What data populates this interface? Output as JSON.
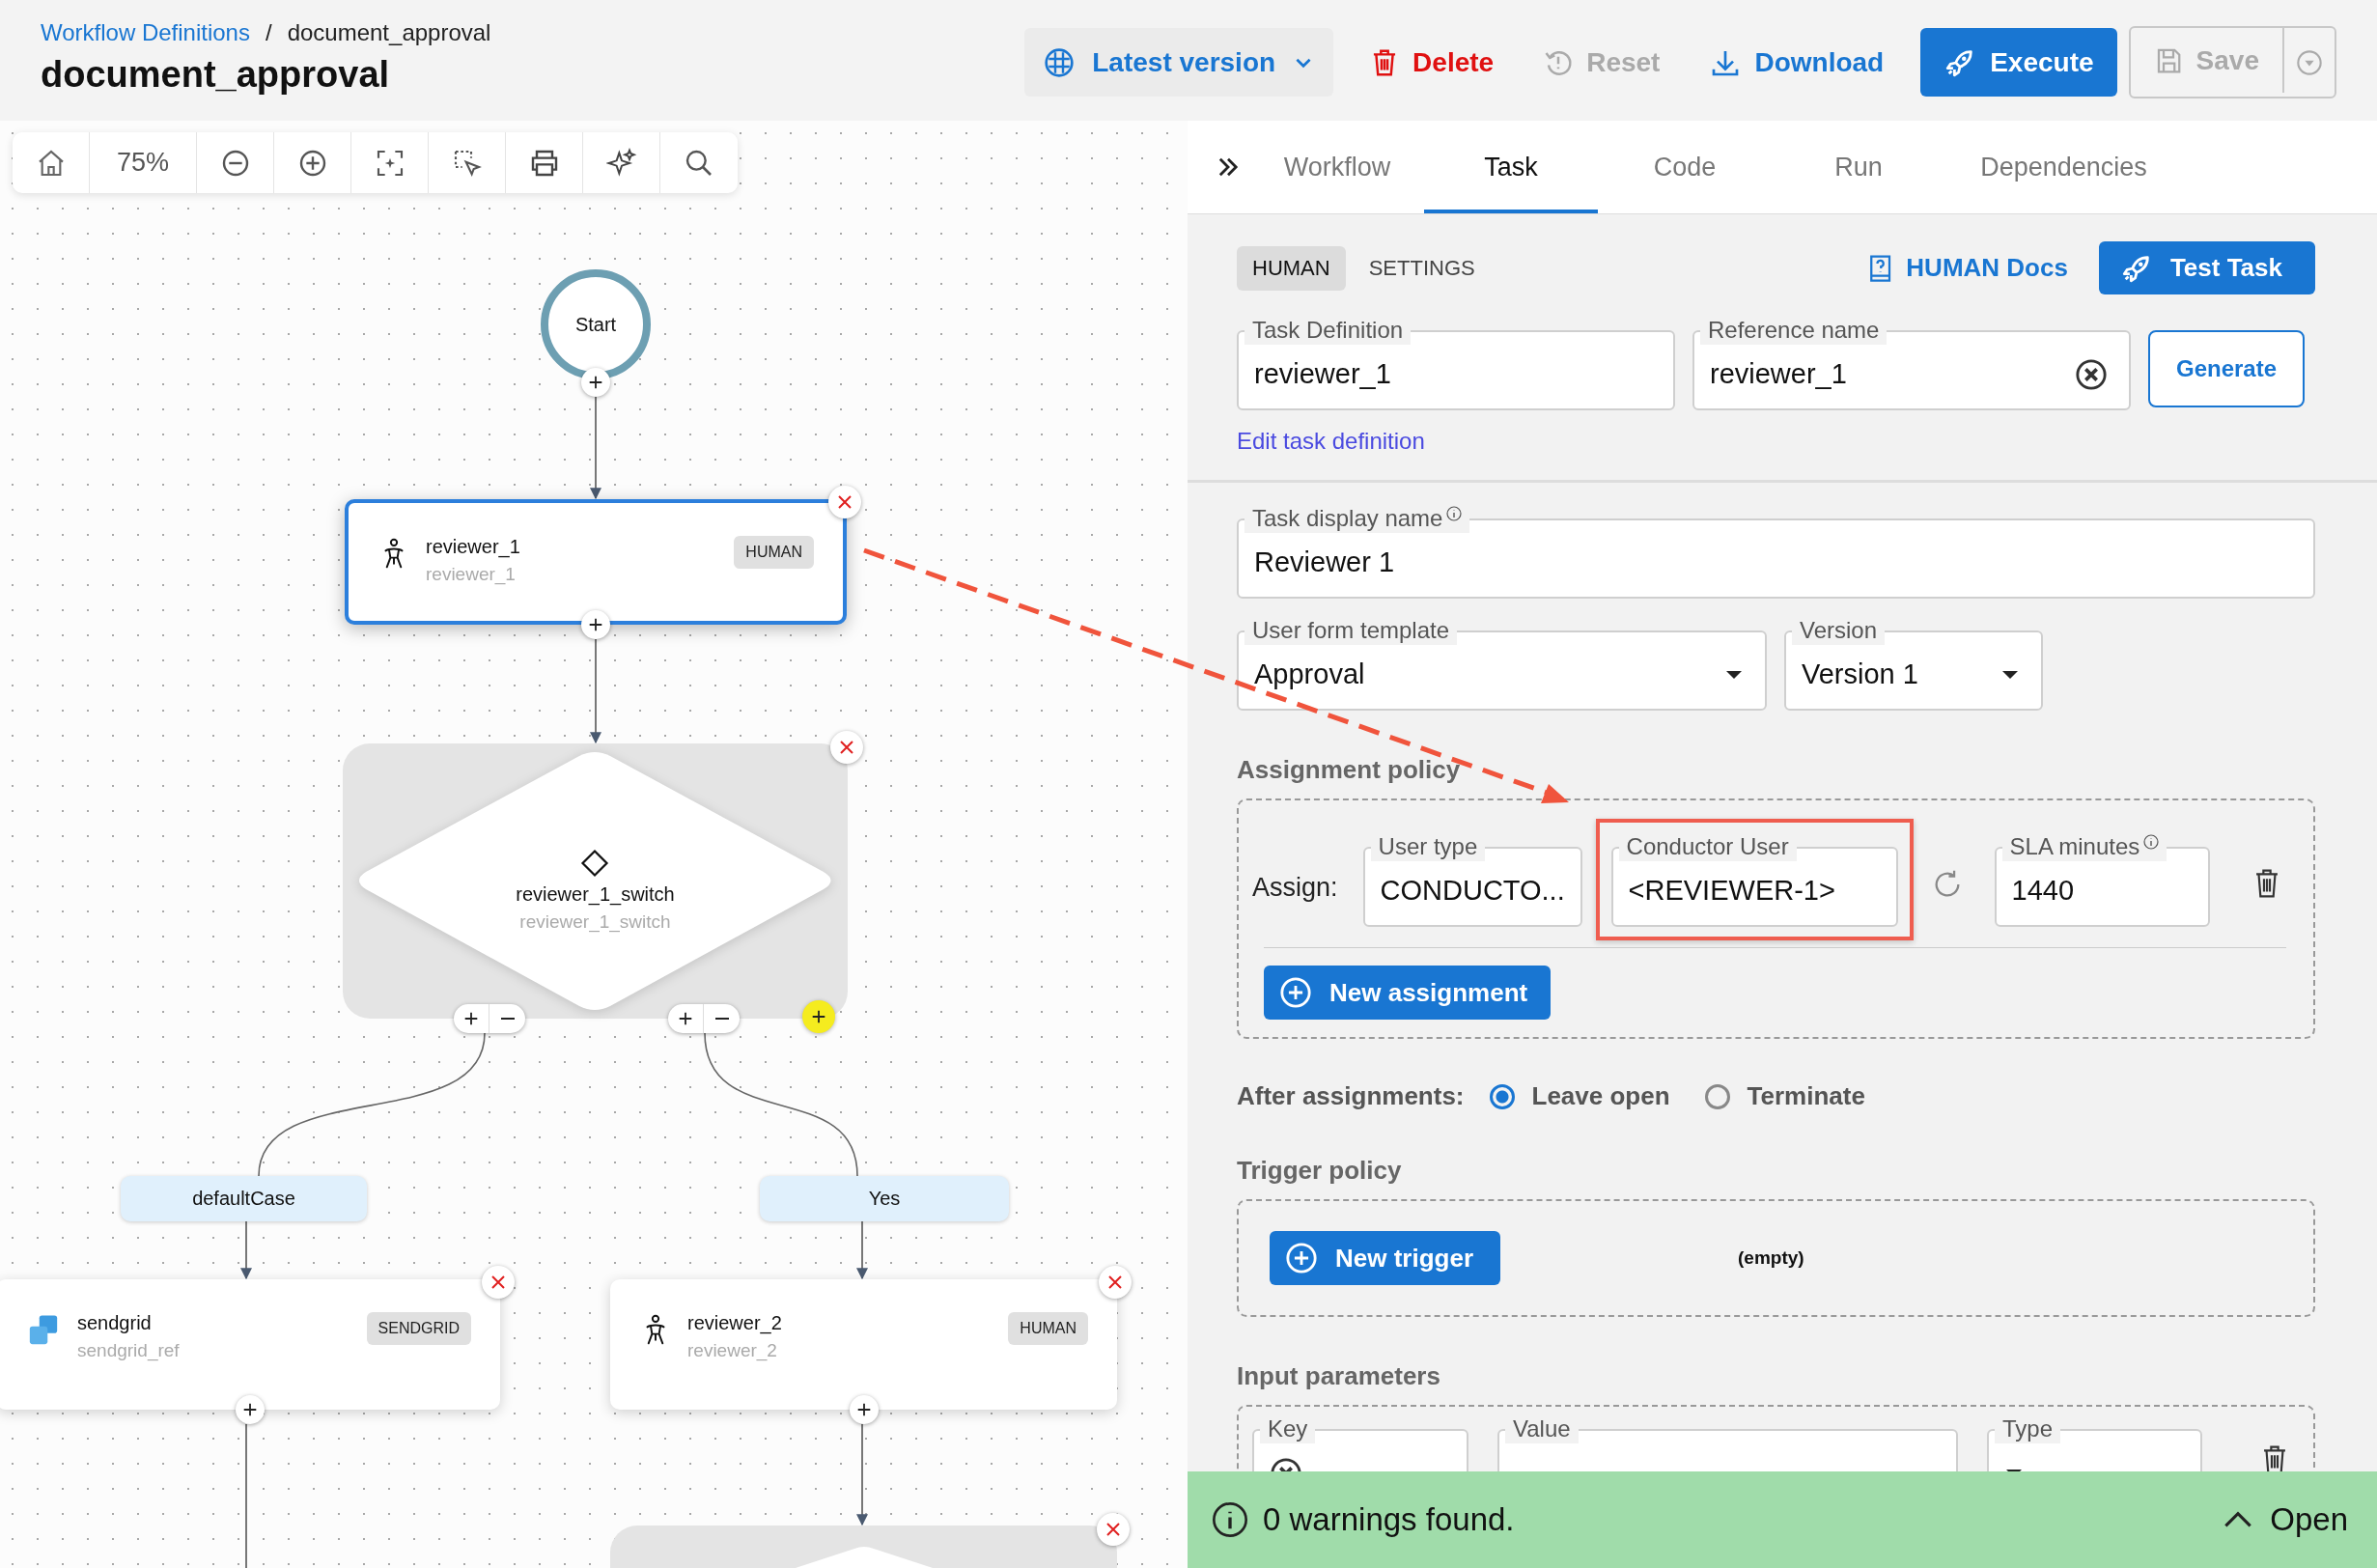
{
  "breadcrumb": [
    {
      "label": "Workflow Definitions",
      "kind": "link"
    },
    {
      "label": "document_approval",
      "kind": "current"
    }
  ],
  "breadcrumb_separator": "/",
  "title": "document_approval",
  "actions": [
    {
      "label": "Latest version",
      "kind": "version",
      "disabled": false
    },
    {
      "label": "Delete",
      "kind": "delete",
      "disabled": false
    },
    {
      "label": "Reset",
      "kind": "reset",
      "disabled": true
    },
    {
      "label": "Download",
      "kind": "download",
      "disabled": false
    },
    {
      "label": "Execute",
      "kind": "execute",
      "disabled": false
    },
    {
      "label": "Save",
      "kind": "save",
      "disabled": true
    }
  ],
  "zoom_level": "75%",
  "nodes": [
    {
      "kind": "start",
      "label": "Start"
    },
    {
      "kind": "human",
      "name": "reviewer_1",
      "ref": "reviewer_1",
      "type": "HUMAN",
      "selected": true
    },
    {
      "kind": "switch",
      "name": "reviewer_1_switch",
      "ref": "reviewer_1_switch"
    },
    {
      "kind": "sendgrid",
      "name": "sendgrid",
      "ref": "sendgrid_ref",
      "type": "SENDGRID",
      "selected": false
    },
    {
      "kind": "human",
      "name": "reviewer_2",
      "ref": "reviewer_2",
      "type": "HUMAN",
      "selected": false
    },
    {
      "kind": "switch-stub"
    }
  ],
  "branches": [
    {
      "label": "defaultCase"
    },
    {
      "label": "Yes"
    }
  ],
  "panel": {
    "tabs": [
      {
        "label": "Workflow",
        "selected": false
      },
      {
        "label": "Task",
        "selected": true
      },
      {
        "label": "Code",
        "selected": false
      },
      {
        "label": "Run",
        "selected": false
      },
      {
        "label": "Dependencies",
        "selected": false
      }
    ],
    "subtabs": [
      {
        "label": "HUMAN",
        "selected": true
      },
      {
        "label": "SETTINGS",
        "selected": false
      }
    ],
    "docs_link": "HUMAN Docs",
    "test_button": "Test Task",
    "task_definition": {
      "label": "Task Definition",
      "value": "reviewer_1"
    },
    "reference_name": {
      "label": "Reference name",
      "value": "reviewer_1"
    },
    "generate_button": "Generate",
    "edit_link": "Edit task definition",
    "display_name": {
      "label": "Task display name",
      "value": "Reviewer 1"
    },
    "user_form_template": {
      "label": "User form template",
      "value": "Approval"
    },
    "version": {
      "label": "Version",
      "value": "Version 1"
    },
    "assignment_policy": {
      "heading": "Assignment policy",
      "assign_label": "Assign:",
      "user_type": {
        "label": "User type",
        "value": "CONDUCTO..."
      },
      "conductor_user": {
        "label": "Conductor User",
        "value": "<REVIEWER-1>",
        "highlighted": true
      },
      "sla": {
        "label": "SLA minutes",
        "value": "1440"
      },
      "new_button": "New assignment"
    },
    "after_assignments": {
      "label": "After assignments:",
      "options": [
        {
          "label": "Leave open",
          "selected": true
        },
        {
          "label": "Terminate",
          "selected": false
        }
      ]
    },
    "trigger_policy": {
      "heading": "Trigger policy",
      "new_button": "New trigger",
      "empty": "(empty)"
    },
    "input_parameters": {
      "heading": "Input parameters",
      "key": {
        "label": "Key"
      },
      "value": {
        "label": "Value"
      },
      "type": {
        "label": "Type"
      }
    }
  },
  "status": {
    "message": "0 warnings found.",
    "open": "Open"
  }
}
